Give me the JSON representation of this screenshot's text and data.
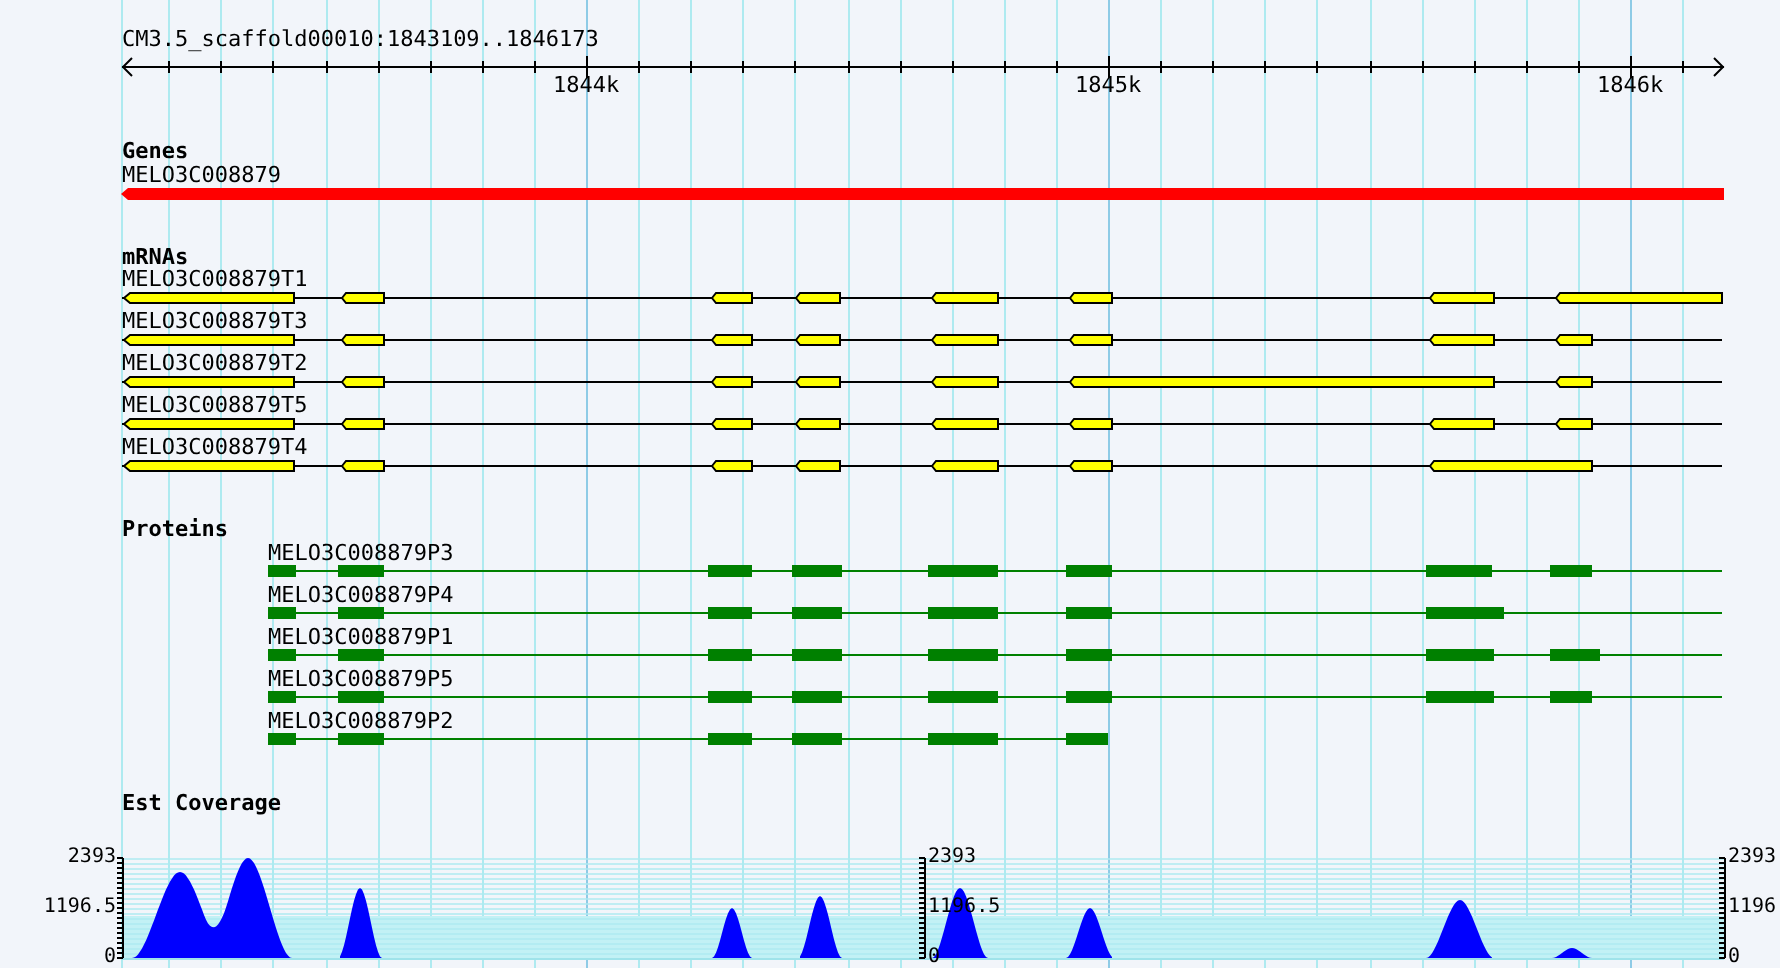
{
  "ruler": {
    "title": "CM3.5_scaffold00010:1843109..1846173",
    "ticks": [
      "1844k",
      "1845k",
      "1846k"
    ]
  },
  "genes": {
    "label": "Genes",
    "items": [
      {
        "name": "MELO3C008879"
      }
    ]
  },
  "mrnas": {
    "label": "mRNAs",
    "items": [
      {
        "name": "MELO3C008879T1"
      },
      {
        "name": "MELO3C008879T3"
      },
      {
        "name": "MELO3C008879T2"
      },
      {
        "name": "MELO3C008879T5"
      },
      {
        "name": "MELO3C008879T4"
      }
    ]
  },
  "proteins": {
    "label": "Proteins",
    "items": [
      {
        "name": "MELO3C008879P3"
      },
      {
        "name": "MELO3C008879P4"
      },
      {
        "name": "MELO3C008879P1"
      },
      {
        "name": "MELO3C008879P5"
      },
      {
        "name": "MELO3C008879P2"
      }
    ]
  },
  "est_coverage": {
    "label": "Est Coverage",
    "scales": [
      {
        "max": "2393",
        "mid": "1196.5",
        "min": "0"
      },
      {
        "max": "2393",
        "mid": "1196.5",
        "min": "0"
      },
      {
        "max": "2393",
        "mid": "1196",
        "min": "0"
      }
    ]
  }
}
